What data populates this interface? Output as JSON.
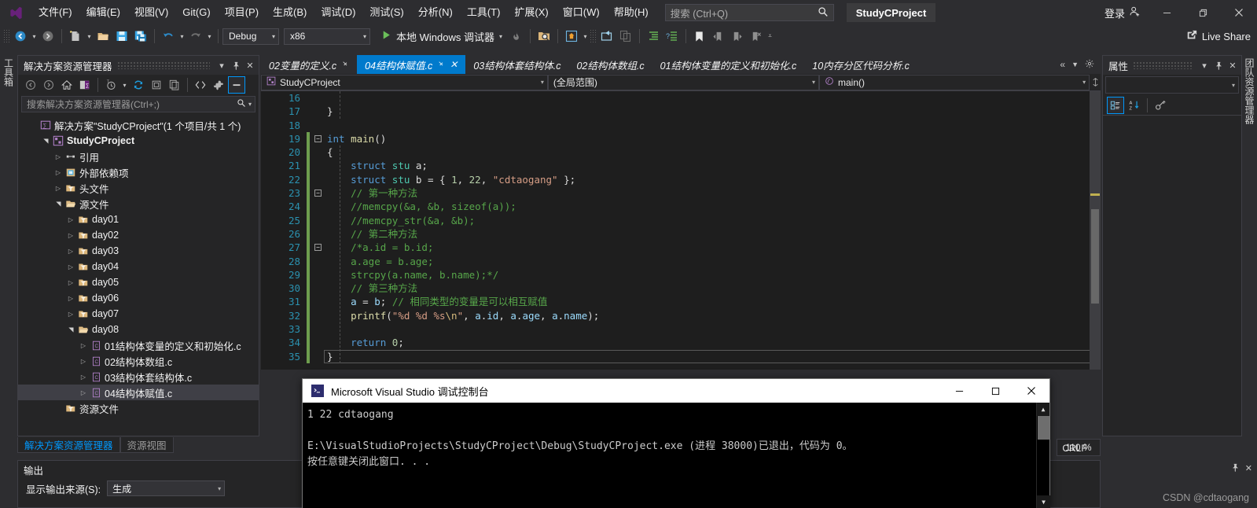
{
  "titlebar": {
    "logo_icon": "visual-studio-logo",
    "menu": [
      {
        "label": "文件(F)"
      },
      {
        "label": "编辑(E)"
      },
      {
        "label": "视图(V)"
      },
      {
        "label": "Git(G)"
      },
      {
        "label": "项目(P)"
      },
      {
        "label": "生成(B)"
      },
      {
        "label": "调试(D)"
      },
      {
        "label": "测试(S)"
      },
      {
        "label": "分析(N)"
      },
      {
        "label": "工具(T)"
      },
      {
        "label": "扩展(X)"
      },
      {
        "label": "窗口(W)"
      },
      {
        "label": "帮助(H)"
      }
    ],
    "search_placeholder": "搜索 (Ctrl+Q)",
    "project_badge": "StudyCProject",
    "signin_label": "登录",
    "minimize": "—",
    "restore": "❐",
    "close": "✕"
  },
  "toolbar": {
    "configuration": "Debug",
    "platform": "x86",
    "run_label": "本地 Windows 调试器",
    "live_share": "Live Share"
  },
  "left_vertical_tab": "工具箱",
  "right_vertical_tab": "团队资源管理器",
  "solution_explorer": {
    "title": "解决方案资源管理器",
    "search_placeholder": "搜索解决方案资源管理器(Ctrl+;)",
    "tree": [
      {
        "label": "解决方案\"StudyCProject\"(1 个项目/共 1 个)",
        "indent": 0,
        "arrow": "",
        "icon": "solution-icon",
        "bold": false,
        "selected": false
      },
      {
        "label": "StudyCProject",
        "indent": 1,
        "arrow": "open",
        "icon": "project-icon",
        "bold": true,
        "selected": false
      },
      {
        "label": "引用",
        "indent": 2,
        "arrow": "closed",
        "icon": "references-icon",
        "bold": false,
        "selected": false
      },
      {
        "label": "外部依赖项",
        "indent": 2,
        "arrow": "closed",
        "icon": "ext-deps-icon",
        "bold": false,
        "selected": false
      },
      {
        "label": "头文件",
        "indent": 2,
        "arrow": "closed",
        "icon": "filter-folder-icon",
        "bold": false,
        "selected": false
      },
      {
        "label": "源文件",
        "indent": 2,
        "arrow": "open",
        "icon": "filter-folder-open-icon",
        "bold": false,
        "selected": false
      },
      {
        "label": "day01",
        "indent": 3,
        "arrow": "closed",
        "icon": "filter-folder-icon",
        "bold": false,
        "selected": false
      },
      {
        "label": "day02",
        "indent": 3,
        "arrow": "closed",
        "icon": "filter-folder-icon",
        "bold": false,
        "selected": false
      },
      {
        "label": "day03",
        "indent": 3,
        "arrow": "closed",
        "icon": "filter-folder-icon",
        "bold": false,
        "selected": false
      },
      {
        "label": "day04",
        "indent": 3,
        "arrow": "closed",
        "icon": "filter-folder-icon",
        "bold": false,
        "selected": false
      },
      {
        "label": "day05",
        "indent": 3,
        "arrow": "closed",
        "icon": "filter-folder-icon",
        "bold": false,
        "selected": false
      },
      {
        "label": "day06",
        "indent": 3,
        "arrow": "closed",
        "icon": "filter-folder-icon",
        "bold": false,
        "selected": false
      },
      {
        "label": "day07",
        "indent": 3,
        "arrow": "closed",
        "icon": "filter-folder-icon",
        "bold": false,
        "selected": false
      },
      {
        "label": "day08",
        "indent": 3,
        "arrow": "open",
        "icon": "filter-folder-open-icon",
        "bold": false,
        "selected": false
      },
      {
        "label": "01结构体变量的定义和初始化.c",
        "indent": 4,
        "arrow": "closed",
        "icon": "c-file-icon",
        "bold": false,
        "selected": false
      },
      {
        "label": "02结构体数组.c",
        "indent": 4,
        "arrow": "closed",
        "icon": "c-file-icon",
        "bold": false,
        "selected": false
      },
      {
        "label": "03结构体套结构体.c",
        "indent": 4,
        "arrow": "closed",
        "icon": "c-file-icon",
        "bold": false,
        "selected": false
      },
      {
        "label": "04结构体赋值.c",
        "indent": 4,
        "arrow": "closed",
        "icon": "c-file-icon",
        "bold": false,
        "selected": true
      },
      {
        "label": "资源文件",
        "indent": 2,
        "arrow": "",
        "icon": "filter-folder-icon",
        "bold": false,
        "selected": false
      }
    ],
    "dock_tabs": [
      {
        "label": "解决方案资源管理器",
        "active": true
      },
      {
        "label": "资源视图",
        "active": false
      }
    ]
  },
  "editor": {
    "tabs": [
      {
        "label": "02变量的定义.c",
        "active": false,
        "pinned": true,
        "closable": false
      },
      {
        "label": "04结构体赋值.c",
        "active": true,
        "pinned": true,
        "closable": true
      },
      {
        "label": "03结构体套结构体.c",
        "active": false,
        "pinned": false,
        "closable": false
      },
      {
        "label": "02结构体数组.c",
        "active": false,
        "pinned": false,
        "closable": false
      },
      {
        "label": "01结构体变量的定义和初始化.c",
        "active": false,
        "pinned": false,
        "closable": false
      },
      {
        "label": "10内存分区代码分析.c",
        "active": false,
        "pinned": false,
        "closable": false
      }
    ],
    "navbar": {
      "project": "StudyCProject",
      "scope": "(全局范围)",
      "member": "main()"
    },
    "first_line_number": 16,
    "lines": [
      {
        "n": 16,
        "tokens": [
          {
            "t": "",
            "c": "pl"
          }
        ]
      },
      {
        "n": 17,
        "tokens": [
          {
            "t": "}",
            "c": "pl"
          }
        ]
      },
      {
        "n": 18,
        "tokens": [
          {
            "t": "",
            "c": "pl"
          }
        ]
      },
      {
        "n": 19,
        "tokens": [
          {
            "t": "int",
            "c": "kw"
          },
          {
            "t": " ",
            "c": "pl"
          },
          {
            "t": "main",
            "c": "fn"
          },
          {
            "t": "()",
            "c": "pl"
          }
        ],
        "fold": "minus"
      },
      {
        "n": 20,
        "tokens": [
          {
            "t": "{",
            "c": "pl"
          }
        ]
      },
      {
        "n": 21,
        "tokens": [
          {
            "t": "    ",
            "c": "pl"
          },
          {
            "t": "struct",
            "c": "kw"
          },
          {
            "t": " ",
            "c": "pl"
          },
          {
            "t": "stu",
            "c": "kw2"
          },
          {
            "t": " a;",
            "c": "pl"
          }
        ]
      },
      {
        "n": 22,
        "tokens": [
          {
            "t": "    ",
            "c": "pl"
          },
          {
            "t": "struct",
            "c": "kw"
          },
          {
            "t": " ",
            "c": "pl"
          },
          {
            "t": "stu",
            "c": "kw2"
          },
          {
            "t": " b = { ",
            "c": "pl"
          },
          {
            "t": "1",
            "c": "nm"
          },
          {
            "t": ", ",
            "c": "pl"
          },
          {
            "t": "22",
            "c": "nm"
          },
          {
            "t": ", ",
            "c": "pl"
          },
          {
            "t": "\"cdtaogang\"",
            "c": "st"
          },
          {
            "t": " };",
            "c": "pl"
          }
        ]
      },
      {
        "n": 23,
        "tokens": [
          {
            "t": "    // 第一种方法",
            "c": "cm"
          }
        ],
        "fold": "minus"
      },
      {
        "n": 24,
        "tokens": [
          {
            "t": "    //memcpy(&a, &b, sizeof(a));",
            "c": "cm"
          }
        ]
      },
      {
        "n": 25,
        "tokens": [
          {
            "t": "    //memcpy_str(&a, &b);",
            "c": "cm"
          }
        ]
      },
      {
        "n": 26,
        "tokens": [
          {
            "t": "    // 第二种方法",
            "c": "cm"
          }
        ]
      },
      {
        "n": 27,
        "tokens": [
          {
            "t": "    /*a.id = b.id;",
            "c": "cm"
          }
        ],
        "fold": "minus"
      },
      {
        "n": 28,
        "tokens": [
          {
            "t": "    a.age = b.age;",
            "c": "cm"
          }
        ]
      },
      {
        "n": 29,
        "tokens": [
          {
            "t": "    strcpy(a.name, b.name);*/",
            "c": "cm"
          }
        ]
      },
      {
        "n": 30,
        "tokens": [
          {
            "t": "    // 第三种方法",
            "c": "cm"
          }
        ]
      },
      {
        "n": 31,
        "tokens": [
          {
            "t": "    ",
            "c": "pl"
          },
          {
            "t": "a",
            "c": "id"
          },
          {
            "t": " = ",
            "c": "pl"
          },
          {
            "t": "b",
            "c": "id"
          },
          {
            "t": "; ",
            "c": "pl"
          },
          {
            "t": "// 相同类型的变量是可以相互赋值",
            "c": "cm"
          }
        ]
      },
      {
        "n": 32,
        "tokens": [
          {
            "t": "    ",
            "c": "pl"
          },
          {
            "t": "printf",
            "c": "fn"
          },
          {
            "t": "(",
            "c": "pl"
          },
          {
            "t": "\"%d %d %s",
            "c": "st"
          },
          {
            "t": "\\n",
            "c": "esc"
          },
          {
            "t": "\"",
            "c": "st"
          },
          {
            "t": ", ",
            "c": "pl"
          },
          {
            "t": "a",
            "c": "id"
          },
          {
            "t": ".",
            "c": "pl"
          },
          {
            "t": "id",
            "c": "id"
          },
          {
            "t": ", ",
            "c": "pl"
          },
          {
            "t": "a",
            "c": "id"
          },
          {
            "t": ".",
            "c": "pl"
          },
          {
            "t": "age",
            "c": "id"
          },
          {
            "t": ", ",
            "c": "pl"
          },
          {
            "t": "a",
            "c": "id"
          },
          {
            "t": ".",
            "c": "pl"
          },
          {
            "t": "name",
            "c": "id"
          },
          {
            "t": ");",
            "c": "pl"
          }
        ]
      },
      {
        "n": 33,
        "tokens": [
          {
            "t": "",
            "c": "pl"
          }
        ]
      },
      {
        "n": 34,
        "tokens": [
          {
            "t": "    ",
            "c": "pl"
          },
          {
            "t": "return",
            "c": "kw"
          },
          {
            "t": " ",
            "c": "pl"
          },
          {
            "t": "0",
            "c": "nm"
          },
          {
            "t": ";",
            "c": "pl"
          }
        ]
      },
      {
        "n": 35,
        "tokens": [
          {
            "t": "}",
            "c": "pl"
          }
        ],
        "cursor": true
      }
    ],
    "zoom": "110 %",
    "line_ending": "CRLF"
  },
  "console": {
    "title": "Microsoft Visual Studio 调试控制台",
    "icon": "console-icon",
    "minimize": "—",
    "maximize": "❐",
    "close": "✕",
    "lines": [
      "1 22 cdtaogang",
      "",
      "E:\\VisualStudioProjects\\StudyCProject\\Debug\\StudyCProject.exe (进程 38000)已退出，代码为 0。",
      "按任意键关闭此窗口. . ."
    ]
  },
  "output": {
    "title": "输出",
    "source_label": "显示输出来源(S):",
    "source_value": "生成"
  },
  "properties": {
    "title": "属性",
    "toolbar_icons": [
      "categorized-icon",
      "alphabetical-icon",
      "properties-key-icon"
    ]
  },
  "watermark": "CSDN @cdtaogang",
  "colors": {
    "accent": "#007acc",
    "chrome": "#2d2d30",
    "panel": "#252526",
    "editor_bg": "#1e1e1e",
    "line_number": "#2b91af",
    "comment": "#57a64a",
    "keyword": "#569cd6",
    "string": "#d69d85",
    "changed_line": "#6e9e4e"
  }
}
